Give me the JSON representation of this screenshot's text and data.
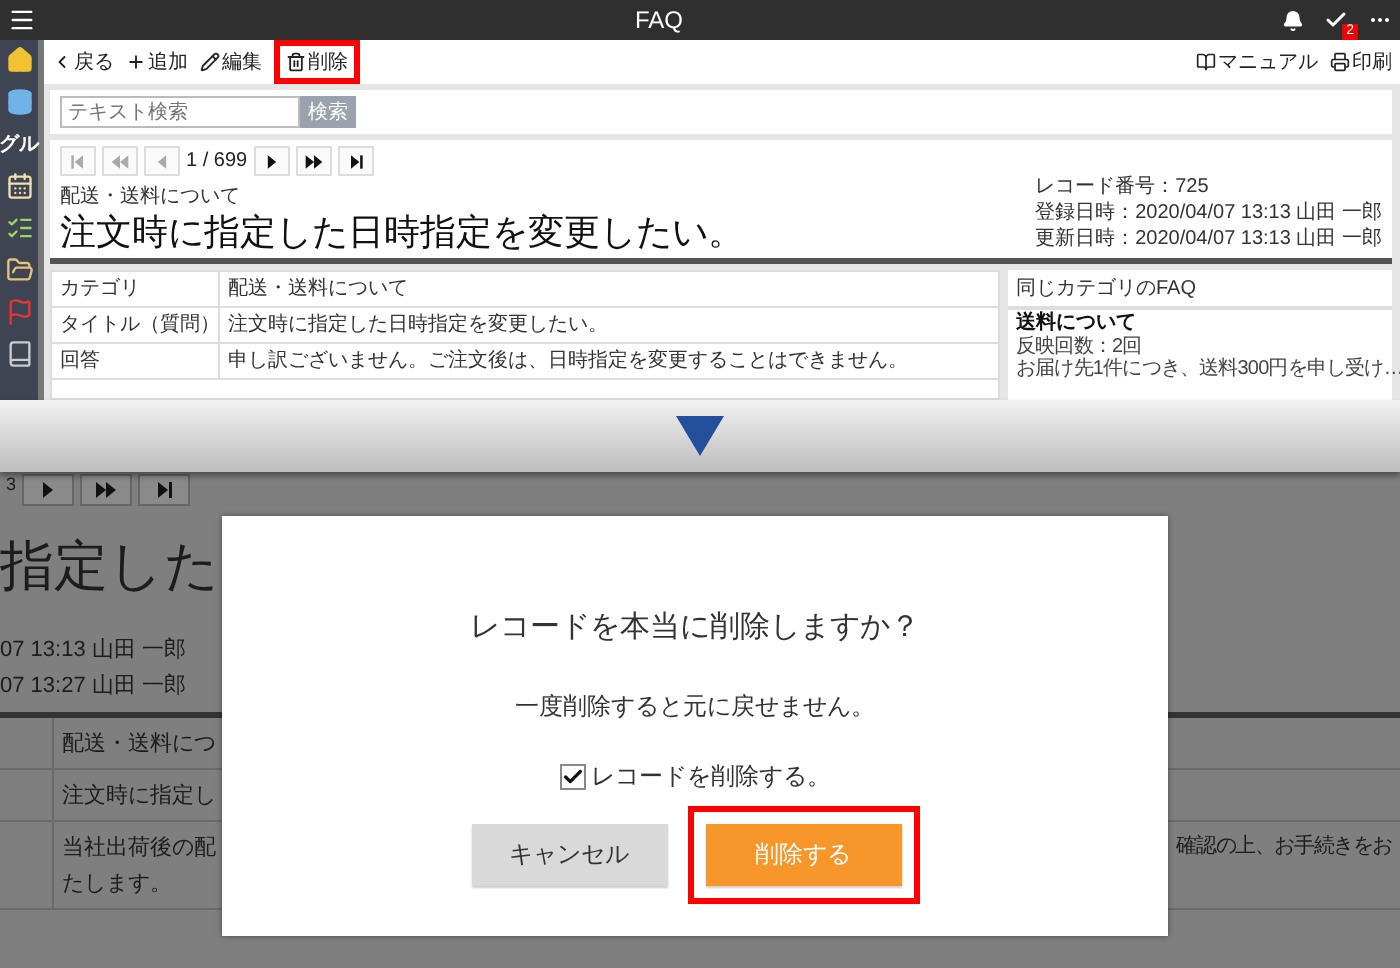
{
  "header": {
    "title": "FAQ",
    "badge": "2"
  },
  "sidebar": {
    "label": "グル"
  },
  "toolbar": {
    "left": [
      {
        "label": "戻る",
        "highlighted": false
      },
      {
        "label": "追加",
        "highlighted": false
      },
      {
        "label": "編集",
        "highlighted": false
      },
      {
        "label": "削除",
        "highlighted": true
      }
    ],
    "right": [
      {
        "label": "マニュアル"
      },
      {
        "label": "印刷"
      }
    ]
  },
  "search": {
    "placeholder": "テキスト検索",
    "button": "検索"
  },
  "pager": {
    "position": "1 / 699",
    "buttons": [
      {
        "kind": "first",
        "disabled": true
      },
      {
        "kind": "rewind",
        "disabled": true
      },
      {
        "kind": "prev",
        "disabled": true
      },
      {
        "kind": "next",
        "disabled": false
      },
      {
        "kind": "forward",
        "disabled": false
      },
      {
        "kind": "last",
        "disabled": false
      }
    ]
  },
  "record": {
    "category": "配送・送料について",
    "title": "注文時に指定した日時指定を変更したい。",
    "meta": [
      "レコード番号：725",
      "登録日時：2020/04/07 13:13 山田 一郎",
      "更新日時：2020/04/07 13:13 山田 一郎"
    ]
  },
  "table": {
    "rows": [
      {
        "label": "カテゴリ",
        "value": "配送・送料について"
      },
      {
        "label": "タイトル（質問）",
        "value": "注文時に指定した日時指定を変更したい。"
      },
      {
        "label": "回答",
        "value": "申し訳ございません。ご注文後は、日時指定を変更することはできません。"
      }
    ]
  },
  "related": {
    "title": "同じカテゴリのFAQ",
    "items": [
      {
        "title": "送料について",
        "count": "反映回数：2回",
        "excerpt": "お届け先1件につき、送料300円を申し受け…"
      }
    ]
  },
  "zoomed_view": {
    "pager_text": "3",
    "pager_buttons": [
      {
        "kind": "next",
        "disabled": false
      },
      {
        "kind": "forward",
        "disabled": false
      },
      {
        "kind": "last",
        "disabled": false
      }
    ],
    "title_fragment": "指定した",
    "meta": [
      "07 13:13 山田 一郎",
      "07 13:27 山田 一郎"
    ],
    "rows": [
      {
        "value": "配送・送料につ"
      },
      {
        "value": "注文時に指定し"
      },
      {
        "value": "当社出荷後の配",
        "continuation": "たします。",
        "right": "確認の上、お手続きをお"
      }
    ]
  },
  "dialog": {
    "title": "レコードを本当に削除しますか？",
    "message": "一度削除すると元に戻せません。",
    "checkbox": {
      "label": "レコードを削除する。",
      "checked": true
    },
    "buttons": [
      {
        "kind": "cancel",
        "label": "キャンセル",
        "highlighted": false
      },
      {
        "kind": "primary",
        "label": "削除する",
        "highlighted": true
      }
    ]
  }
}
